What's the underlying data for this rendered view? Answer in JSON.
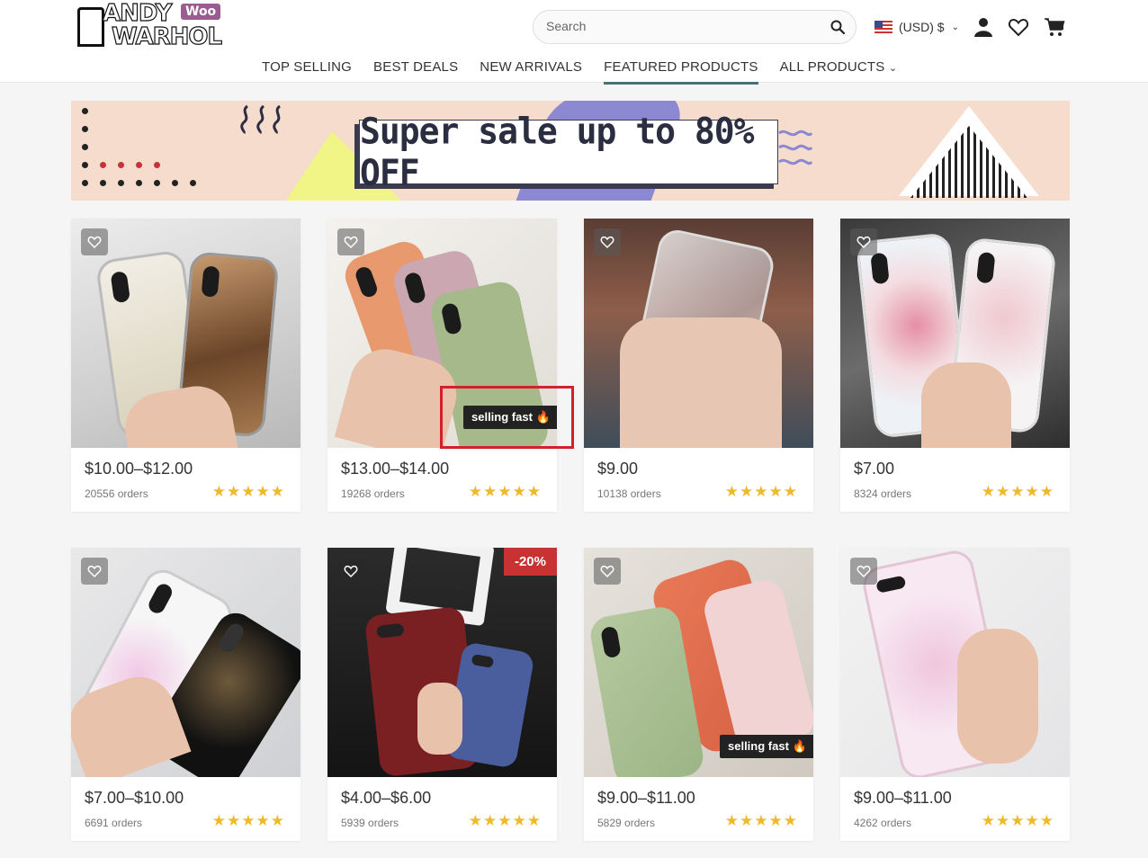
{
  "logo": {
    "line1": "ANDY",
    "line2": "WARHOL",
    "badge": "Woo"
  },
  "search": {
    "placeholder": "Search"
  },
  "currency": {
    "label": "(USD) $"
  },
  "nav": [
    "TOP SELLING",
    "BEST DEALS",
    "NEW ARRIVALS",
    "FEATURED PRODUCTS",
    "ALL PRODUCTS"
  ],
  "nav_active": "FEATURED PRODUCTS",
  "banner": {
    "text": "Super sale up to 80% OFF"
  },
  "rating_stars": "★★★★★",
  "products": [
    {
      "price": "$10.00–$12.00",
      "orders": "20556 orders"
    },
    {
      "price": "$13.00–$14.00",
      "orders": "19268 orders",
      "badge": "selling fast 🔥"
    },
    {
      "price": "$9.00",
      "orders": "10138 orders"
    },
    {
      "price": "$7.00",
      "orders": "8324 orders"
    },
    {
      "price": "$7.00–$10.00",
      "orders": "6691 orders"
    },
    {
      "price": "$4.00–$6.00",
      "orders": "5939 orders",
      "discount": "-20%"
    },
    {
      "price": "$9.00–$11.00",
      "orders": "5829 orders",
      "badge": "selling fast 🔥"
    },
    {
      "price": "$9.00–$11.00",
      "orders": "4262 orders"
    }
  ],
  "colors": {
    "accent": "#4a7075",
    "star": "#f0b92a",
    "discount": "#c83232",
    "highlight": "#d4202a"
  }
}
